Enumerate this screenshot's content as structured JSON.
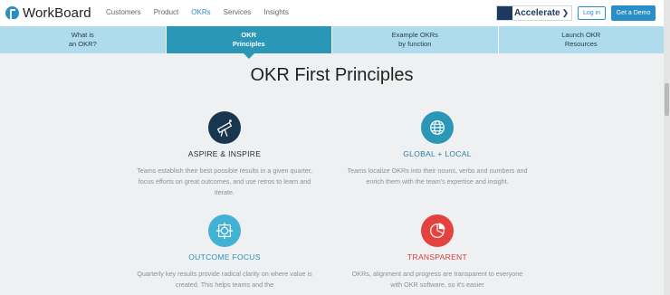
{
  "brand": {
    "name": "WorkBoard"
  },
  "nav": {
    "links": [
      "Customers",
      "Product",
      "OKRs",
      "Services",
      "Insights"
    ],
    "active": "OKRs",
    "accelerate_label": "Accelerate",
    "login_label": "Log in",
    "demo_label": "Get a Demo"
  },
  "tabs": [
    {
      "label": "What is\nan OKR?"
    },
    {
      "label": "OKR\nPrinciples"
    },
    {
      "label": "Example OKRs\nby function"
    },
    {
      "label": "Launch OKR\nResources"
    }
  ],
  "active_tab": 1,
  "main": {
    "title": "OKR First Principles",
    "principles": [
      {
        "title": "ASPIRE & INSPIRE",
        "icon": "telescope-icon",
        "color": "#1a3550",
        "description": "Teams establish their best possible results in a given quarter, focus efforts on great outcomes, and use retros to learn and iterate."
      },
      {
        "title": "GLOBAL + LOCAL",
        "icon": "globe-icon",
        "color": "#2b97b6",
        "description": "Teams localize OKRs into their nouns, verbs and numbers and enrich them with the team's expertise and insight."
      },
      {
        "title": "OUTCOME FOCUS",
        "icon": "target-icon",
        "color": "#42b2d2",
        "description": "Quarterly key results provide radical clarity on where value is created. This helps teams and the"
      },
      {
        "title": "TRANSPARENT",
        "icon": "pie-chart-icon",
        "color": "#e4423f",
        "description": "OKRs, alignment and progress are transparent to everyone with OKR software, so it's easier"
      }
    ]
  }
}
